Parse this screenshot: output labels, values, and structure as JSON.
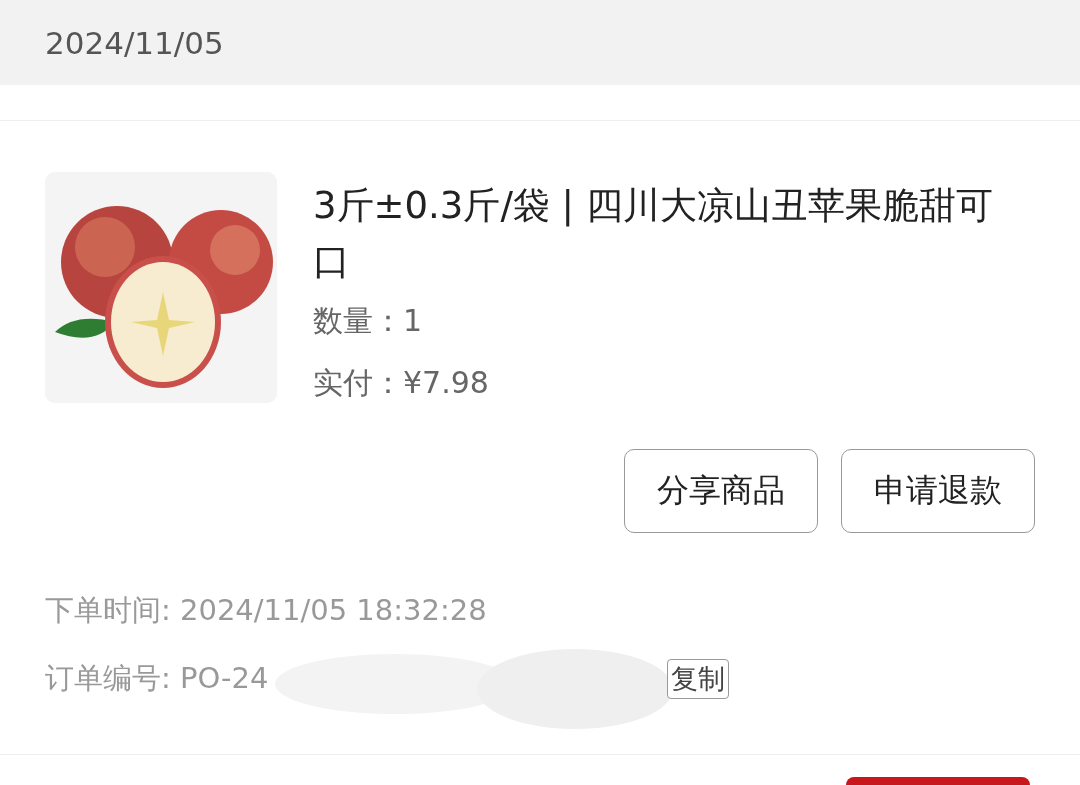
{
  "header": {
    "date": "2024/11/05"
  },
  "product": {
    "title": "3斤±0.3斤/袋 | 四川大凉山丑苹果脆甜可口",
    "quantity_label": "数量：",
    "quantity": "1",
    "paid_label": "实付：",
    "paid": "¥7.98"
  },
  "actions": [
    "分享商品",
    "申请退款"
  ],
  "order_info": {
    "time_label": "下单时间:",
    "time": "2024/11/05 18:32:28",
    "number_label": "订单编号:",
    "number": "PO-24",
    "copy_button": "复制"
  }
}
